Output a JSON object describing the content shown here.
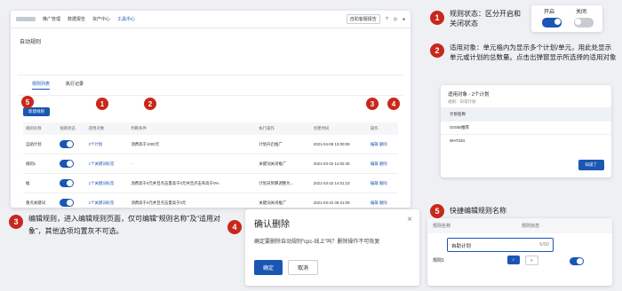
{
  "app": {
    "topbar": {
      "nav": [
        "推广管理",
        "数据报告",
        "资产中心",
        "工具中心"
      ],
      "right": [
        "自助客服报告"
      ]
    },
    "breadcrumb": "自动规则",
    "tabs": [
      "规则列表",
      "执行记录"
    ],
    "new_button": "新建规则",
    "columns": [
      "规则名称",
      "规则状态",
      "适用对象",
      "判断条件",
      "执行操作",
      "创建时间",
      "操作"
    ],
    "rows": [
      {
        "name": "自助计划",
        "target": "2个计划",
        "cond": "消费高于1000元",
        "action": "计划开启推广",
        "time": "2021-04-08 13:00:08"
      },
      {
        "name": "规则1",
        "target": "1个关键词标签",
        "cond": "-",
        "action": "关键词关闭推广",
        "time": "2021-03-22 14:02:45"
      },
      {
        "name": "推",
        "target": "1个关键词标签",
        "cond": "消费高于0元并且点击量高于0元并且点击率高于0%",
        "action": "计划日预算调整为...",
        "time": "2021-03-22 14:01:23"
      },
      {
        "name": "重点关键词",
        "target": "1个关键词标签",
        "cond": "消费高于0元并且点击量高于0元",
        "action": "关键词关闭推广",
        "time": "2021-03-22 09:21:09"
      }
    ],
    "op_edit": "编辑",
    "op_delete": "删除"
  },
  "note1": {
    "num": "1",
    "text": "规则状态：区分开启和关闭状态",
    "on": "开启",
    "off": "关闭"
  },
  "note2": {
    "num": "2",
    "text": "适用对象：单元格内为显示多个计划/单元，用此处显示单元或计划的总数量。点击出弹窗显示所选择的适用对象"
  },
  "modal1": {
    "title": "适用对象 - 2个计划",
    "sub": "规则：日常计划",
    "items": [
      "计划名称",
      "GOSE推荐",
      "WAT234"
    ],
    "ok": "知道了"
  },
  "note3": {
    "num": "3",
    "text": "编辑规则，进入编辑规则页面，仅可编辑“规则名称”及“适用对象”，其他选项均置灰不可选。"
  },
  "note4": {
    "num": "4",
    "title": "确认删除",
    "text": "确定要删除自动规则“cpc-线上”吗？删除操作不可恢复",
    "ok": "确定",
    "cancel": "取消"
  },
  "note5": {
    "num": "5",
    "title": "快捷编辑规则名称",
    "col1": "规则名称",
    "col2": "规则状态",
    "val": "自助计划",
    "count": "6/50",
    "r2": "规则1"
  }
}
